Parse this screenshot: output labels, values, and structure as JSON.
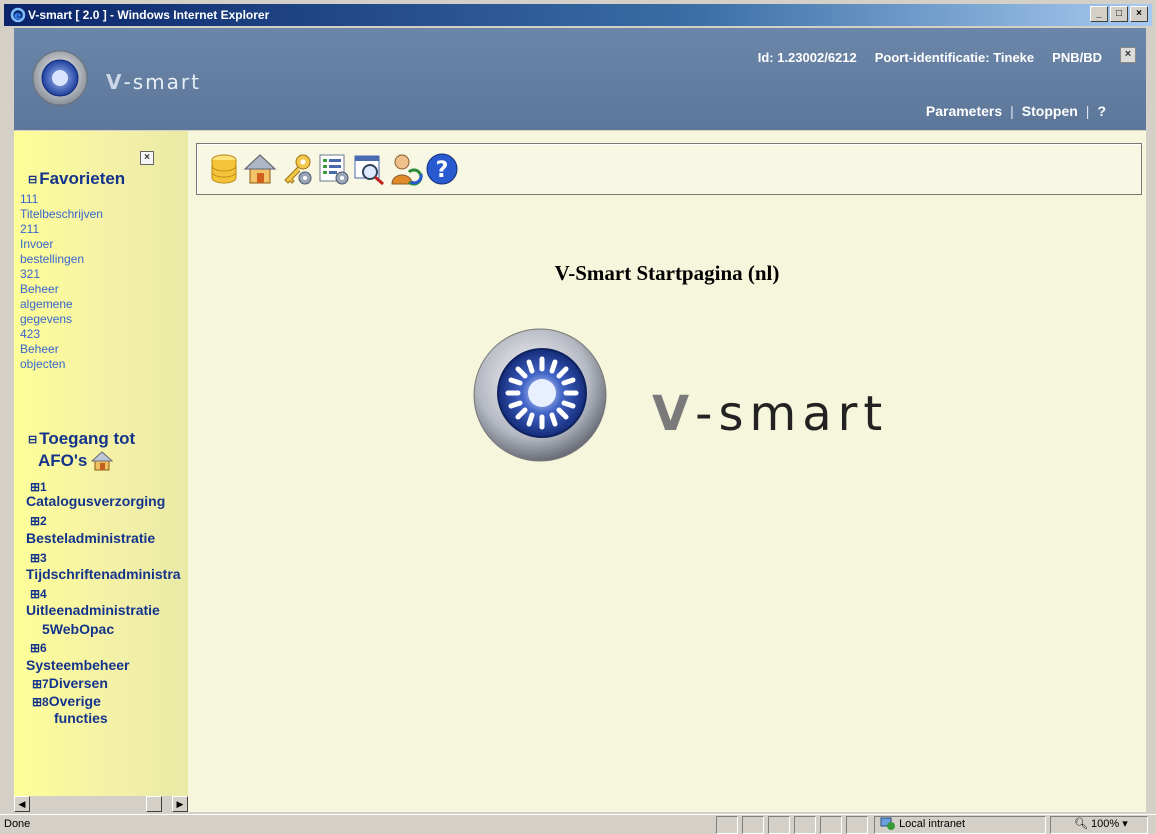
{
  "window": {
    "title": "V-smart [ 2.0 ] - Windows Internet Explorer",
    "buttons": [
      "_",
      "□",
      "×"
    ]
  },
  "header": {
    "brand_v": "V",
    "brand_rest": "-smart",
    "id_text": "Id: 1.23002/6212",
    "port_text": "Poort-identificatie: Tineke",
    "location": "PNB/BD",
    "close_glyph": "×",
    "links": [
      "Parameters",
      "Stoppen",
      "?"
    ],
    "separator": "|"
  },
  "sidebar": {
    "close_glyph": "×",
    "favorites_title": "Favorieten",
    "favorites": [
      "111",
      "Titelbeschrijven",
      "211",
      "Invoer",
      "bestellingen",
      "321",
      "Beheer",
      "algemene",
      "gegevens",
      "423",
      "Beheer",
      "objecten"
    ],
    "access_title": "Toegang tot",
    "access_title2": "AFO's",
    "groups": [
      {
        "num": "⊞1",
        "label": "Catalogusverzorging"
      },
      {
        "num": "⊞2",
        "label": "Besteladministratie"
      },
      {
        "num": "⊞3",
        "label": "Tijdschriftenadministra"
      },
      {
        "num": "⊞4",
        "label": "Uitleenadministratie"
      },
      {
        "num": "5",
        "label": "WebOpac"
      },
      {
        "num": "⊞6",
        "label": "Systeembeheer"
      },
      {
        "num": "⊞7",
        "label": "Diversen"
      },
      {
        "num": "⊞8",
        "label": "Overige"
      },
      {
        "num": "",
        "label": "functies"
      }
    ]
  },
  "toolbar": {
    "icons": [
      "database-icon",
      "home-icon",
      "key-settings-icon",
      "list-settings-icon",
      "search-record-icon",
      "user-refresh-icon",
      "help-icon"
    ]
  },
  "main": {
    "title": "V-Smart Startpagina (nl)",
    "brand_v": "V",
    "brand_rest": "-smart"
  },
  "statusbar": {
    "done": "Done",
    "zone": "Local intranet",
    "zoom": "100%"
  }
}
